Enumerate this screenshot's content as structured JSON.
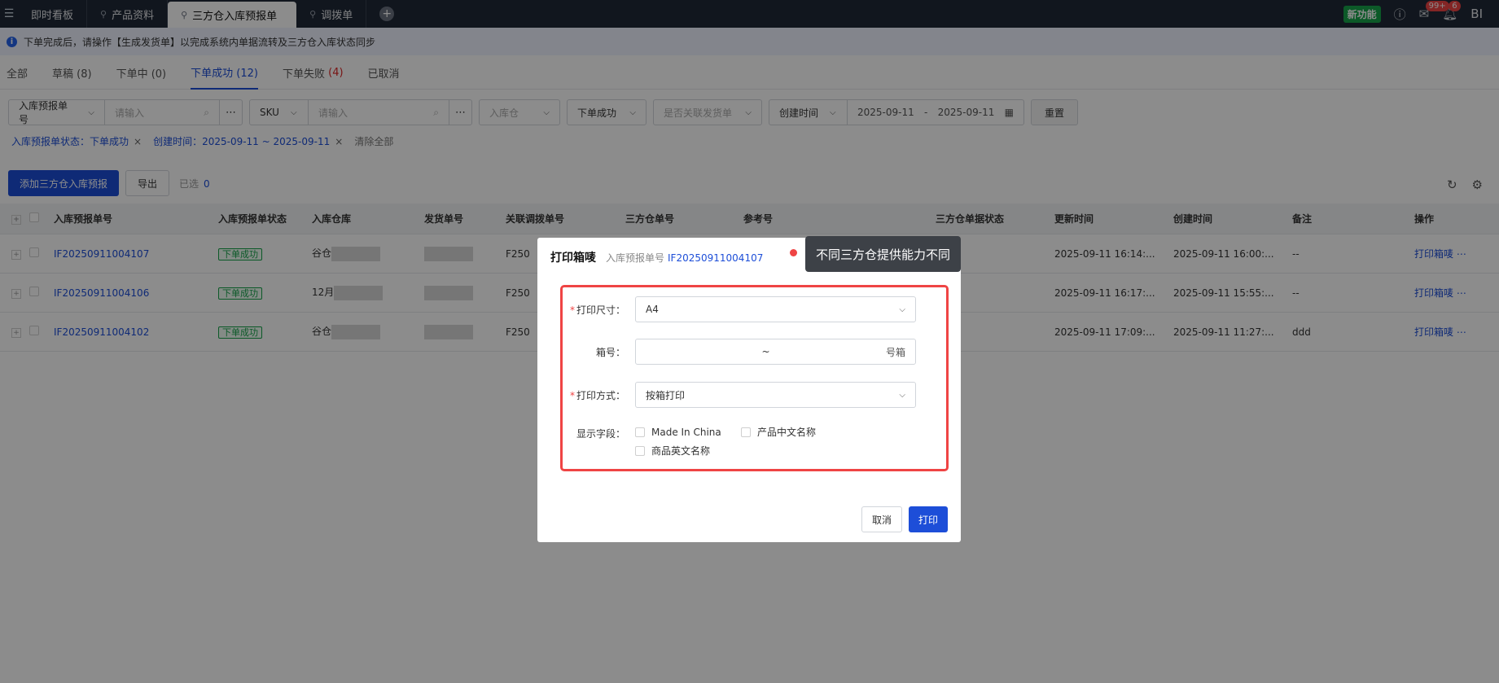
{
  "topbar": {
    "tabs": [
      {
        "label": "即时看板"
      },
      {
        "label": "产品资料"
      },
      {
        "label": "三方仓入库预报单"
      },
      {
        "label": "调拨单"
      }
    ],
    "add_tab": "+",
    "new_feature": "新功能",
    "mail_badge": "99+",
    "bell_badge": "6",
    "user_initials": "BI"
  },
  "notice": {
    "text": "下单完成后，请操作【生成发货单】以完成系统内单据流转及三方仓入库状态同步"
  },
  "status_tabs": {
    "all": "全部",
    "draft": "草稿 (8)",
    "ordering": "下单中 (0)",
    "success": "下单成功 (12)",
    "failed_label": "下单失败",
    "failed_count": "(4)",
    "cancelled": "已取消"
  },
  "filters": {
    "asn_field": "入库预报单号",
    "asn_placeholder": "请输入",
    "sku_field": "SKU",
    "sku_placeholder": "请输入",
    "warehouse_placeholder": "入库仓",
    "status_value": "下单成功",
    "linked_placeholder": "是否关联发货单",
    "time_field": "创建时间",
    "date_start": "2025-09-11",
    "date_sep": "-",
    "date_end": "2025-09-11",
    "reset": "重置"
  },
  "chips": {
    "status": "入库预报单状态：下单成功",
    "created": "创建时间：2025-09-11 ~ 2025-09-11",
    "clear": "清除全部"
  },
  "actions": {
    "add": "添加三方仓入库预报",
    "export": "导出",
    "selected_label": "已选",
    "selected_count": "0"
  },
  "table": {
    "headers": [
      "入库预报单号",
      "入库预报单状态",
      "入库仓库",
      "发货单号",
      "关联调拨单号",
      "三方仓单号",
      "参考号",
      "三方仓单据状态",
      "更新时间",
      "创建时间",
      "备注",
      "操作"
    ],
    "rows": [
      {
        "asn": "IF20250911004107",
        "status": "下单成功",
        "wh": "谷仓",
        "transfer": "F250",
        "updated": "2025-09-11 16:14:...",
        "created": "2025-09-11 16:00:...",
        "note": "--",
        "op": "打印箱唛"
      },
      {
        "asn": "IF20250911004106",
        "status": "下单成功",
        "wh": "12月",
        "transfer": "F250",
        "updated": "2025-09-11 16:17:...",
        "created": "2025-09-11 15:55:...",
        "note": "--",
        "op": "打印箱唛"
      },
      {
        "asn": "IF20250911004102",
        "status": "下单成功",
        "wh": "谷仓",
        "transfer": "F250",
        "updated": "2025-09-11 17:09:...",
        "created": "2025-09-11 11:27:...",
        "note": "ddd",
        "op": "打印箱唛"
      }
    ]
  },
  "modal": {
    "title": "打印箱唛",
    "sub_label": "入库预报单号",
    "sub_value": "IF20250911004107",
    "size_label": "打印尺寸：",
    "size_value": "A4",
    "box_label": "箱号：",
    "box_sep": "~",
    "box_suffix": "号箱",
    "method_label": "打印方式：",
    "method_value": "按箱打印",
    "fields_label": "显示字段：",
    "fields": [
      "Made In China",
      "产品中文名称",
      "商品英文名称"
    ],
    "cancel": "取消",
    "print": "打印"
  },
  "callout": {
    "text": "不同三方仓提供能力不同"
  },
  "colors": {
    "primary": "#1d4ed8",
    "success": "#16a34a",
    "highlight": "#ef4444"
  }
}
